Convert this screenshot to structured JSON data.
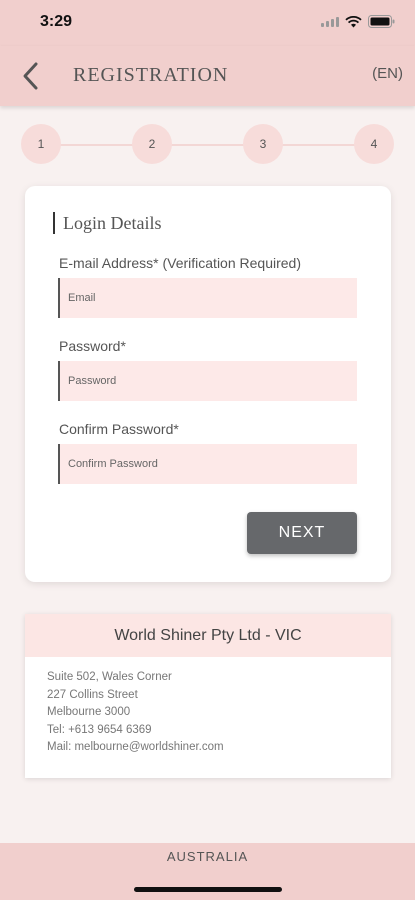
{
  "status_bar": {
    "time": "3:29"
  },
  "nav": {
    "title": "REGISTRATION",
    "language": "(EN)"
  },
  "stepper": {
    "steps": [
      "1",
      "2",
      "3",
      "4"
    ]
  },
  "login": {
    "title": "Login Details",
    "email_label": "E-mail Address* (Verification Required)",
    "email_placeholder": "Email",
    "email_value": "",
    "password_label": "Password*",
    "password_placeholder": "Password",
    "password_value": "",
    "confirm_label": "Confirm Password*",
    "confirm_placeholder": "Confirm Password",
    "confirm_value": "",
    "next_label": "NEXT"
  },
  "office": {
    "name": "World Shiner Pty Ltd - VIC",
    "lines": [
      "Suite 502, Wales Corner",
      "227 Collins Street",
      "Melbourne 3000",
      "Tel: +613 9654 6369",
      "Mail: melbourne@worldshiner.com"
    ]
  },
  "footer": {
    "country": "AUSTRALIA"
  },
  "colors": {
    "header_pink": "#f1cfcd",
    "field_pink": "#fde9e8",
    "button_gray": "#66686b",
    "background": "#f8f1f0"
  },
  "icons": [
    "signal-icon",
    "wifi-icon",
    "battery-icon",
    "back-arrow-icon"
  ]
}
